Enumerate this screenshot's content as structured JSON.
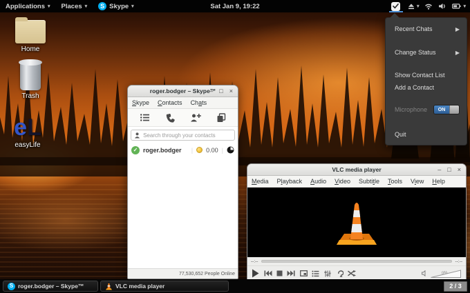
{
  "top_bar": {
    "applications_label": "Applications",
    "places_label": "Places",
    "skype_label": "Skype",
    "clock": "Sat Jan 9, 19:22"
  },
  "desktop_icons": {
    "home_label": "Home",
    "trash_label": "Trash",
    "easylife_label": "easyLife",
    "easylife_logo_e": "e",
    "easylife_logo_l": "L"
  },
  "tray_menu": {
    "recent_chats": "Recent Chats",
    "change_status": "Change Status",
    "show_contact_list": "Show Contact List",
    "add_a_contact": "Add a Contact",
    "microphone": "Microphone",
    "microphone_state": "ON",
    "quit": "Quit"
  },
  "skype_window": {
    "title": "roger.bodger – Skype™",
    "menus": [
      "Skype",
      "Contacts",
      "Chats"
    ],
    "search_placeholder": "Search through your contacts",
    "contact_name": "roger.bodger",
    "balance": "0.00",
    "separator": "|",
    "people_online": "77,530,652 People Online",
    "status_check": "✓"
  },
  "vlc_window": {
    "title": "VLC media player",
    "menus": [
      "Media",
      "Playback",
      "Audio",
      "Video",
      "Subtitle",
      "Tools",
      "View",
      "Help"
    ],
    "time_elapsed": "--:--",
    "time_remaining": "--:--",
    "volume_percent": "0%"
  },
  "taskbar": {
    "skype_task": "roger.bodger – Skype™",
    "vlc_task": "VLC media player",
    "workspace_indicator": "2 / 3",
    "skype_initial": "S"
  },
  "window_controls": {
    "minimize": "–",
    "maximize": "□",
    "close": "×"
  },
  "colors": {
    "accent_blue": "#4a90d9",
    "skype_blue": "#00aff0",
    "toggle_on_blue": "#2d5d94",
    "vlc_orange": "#f58220",
    "online_green": "#62b356"
  }
}
